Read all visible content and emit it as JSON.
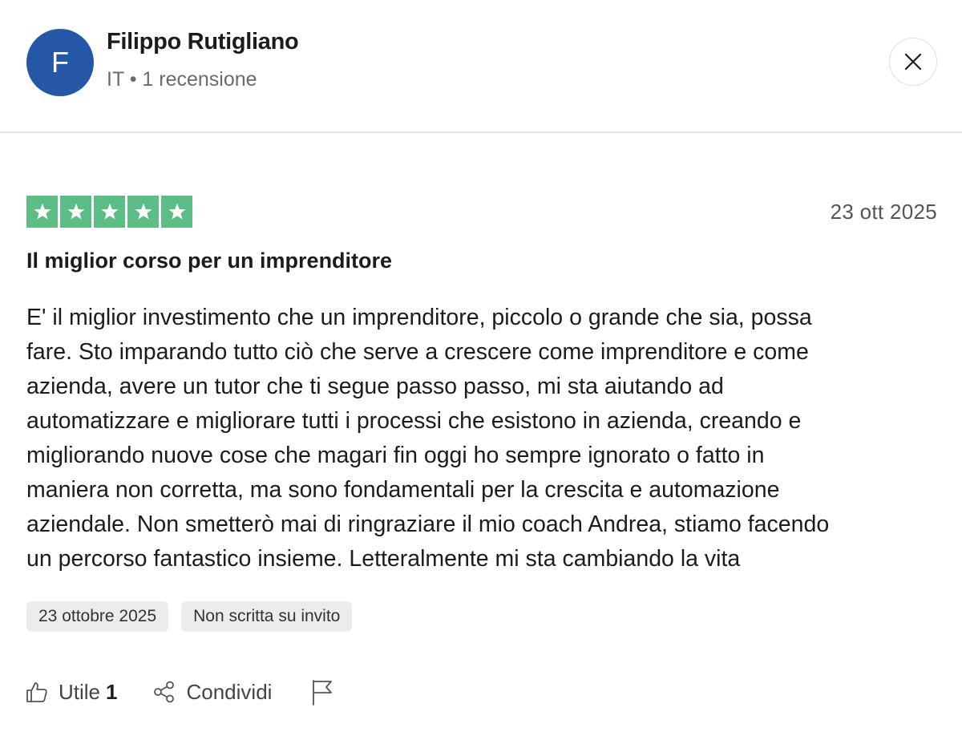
{
  "reviewer": {
    "initial": "F",
    "name": "Filippo Rutigliano",
    "meta": "IT • 1 recensione",
    "avatar_color": "#2458a6"
  },
  "review": {
    "rating": 5,
    "rating_max": 5,
    "star_color": "#5cbd85",
    "date": "23 ott 2025",
    "title": "Il miglior corso per un imprenditore",
    "body": "E' il miglior investimento che un imprenditore, piccolo o grande che sia, possa\nfare. Sto imparando tutto ciò che serve a crescere come imprenditore e come\nazienda, avere un tutor che ti segue passo passo, mi sta aiutando ad\nautomatizzare e migliorare tutti i processi che esistono in azienda, creando e\nmigliorando nuove cose che magari fin oggi ho sempre ignorato o fatto in\nmaniera non corretta, ma sono fondamentali per la crescita e automazione\naziendale. Non smetterò mai di ringraziare il mio coach Andrea, stiamo facendo\nun percorso fantastico insieme. Letteralmente mi sta cambiando la vita",
    "badges": [
      "23 ottobre 2025",
      "Non scritta su invito"
    ]
  },
  "actions": {
    "useful_label": "Utile",
    "useful_count": "1",
    "share_label": "Condividi"
  },
  "icons": {
    "close": "close-icon",
    "star": "star-icon",
    "thumbs_up": "thumbs-up-icon",
    "share": "share-icon",
    "flag": "flag-icon"
  }
}
